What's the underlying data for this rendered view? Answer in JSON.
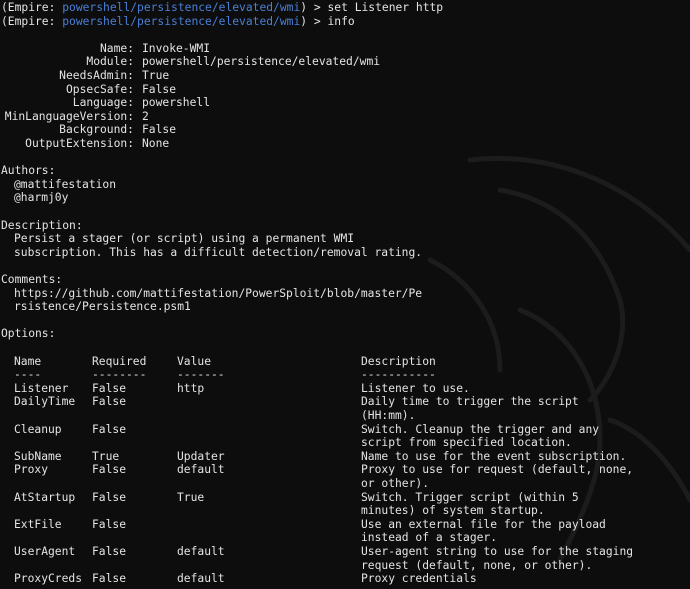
{
  "prompt": {
    "prefix": "(Empire: ",
    "path": "powershell/persistence/elevated/wmi",
    "suffix": ") > "
  },
  "commands": [
    "set Listener http",
    "info"
  ],
  "module_info": [
    {
      "key": "Name",
      "value": "Invoke-WMI"
    },
    {
      "key": "Module",
      "value": "powershell/persistence/elevated/wmi"
    },
    {
      "key": "NeedsAdmin",
      "value": "True"
    },
    {
      "key": "OpsecSafe",
      "value": "False"
    },
    {
      "key": "Language",
      "value": "powershell"
    },
    {
      "key": "MinLanguageVersion",
      "value": "2"
    },
    {
      "key": "Background",
      "value": "False"
    },
    {
      "key": "OutputExtension",
      "value": "None"
    }
  ],
  "authors": {
    "heading": "Authors:",
    "names": [
      "@mattifestation",
      "@harmj0y"
    ]
  },
  "description": {
    "heading": "Description:",
    "lines": [
      "Persist a stager (or script) using a permanent WMI",
      "subscription. This has a difficult detection/removal rating."
    ]
  },
  "comments": {
    "heading": "Comments:",
    "lines": [
      "https://github.com/mattifestation/PowerSploit/blob/master/Pe",
      "rsistence/Persistence.psm1"
    ]
  },
  "options": {
    "heading": "Options:",
    "headers": [
      "Name",
      "Required",
      "Value",
      "Description"
    ],
    "underlines": [
      "----",
      "--------",
      "-------",
      "-----------"
    ],
    "rows": [
      {
        "name": "Listener",
        "required": "False",
        "value": "http",
        "desc": [
          "Listener to use."
        ]
      },
      {
        "name": "DailyTime",
        "required": "False",
        "value": "",
        "desc": [
          "Daily time to trigger the script",
          "(HH:mm)."
        ]
      },
      {
        "name": "Cleanup",
        "required": "False",
        "value": "",
        "desc": [
          "Switch. Cleanup the trigger and any",
          "script from specified location."
        ]
      },
      {
        "name": "SubName",
        "required": "True",
        "value": "Updater",
        "desc": [
          "Name to use for the event subscription."
        ]
      },
      {
        "name": "Proxy",
        "required": "False",
        "value": "default",
        "desc": [
          "Proxy to use for request (default, none,",
          "or other)."
        ]
      },
      {
        "name": "AtStartup",
        "required": "False",
        "value": "True",
        "desc": [
          "Switch. Trigger script (within 5",
          "minutes) of system startup."
        ]
      },
      {
        "name": "ExtFile",
        "required": "False",
        "value": "",
        "desc": [
          "Use an external file for the payload",
          "instead of a stager."
        ]
      },
      {
        "name": "UserAgent",
        "required": "False",
        "value": "default",
        "desc": [
          "User-agent string to use for the staging",
          "request (default, none, or other)."
        ]
      },
      {
        "name": "ProxyCreds",
        "required": "False",
        "value": "default",
        "desc": [
          "Proxy credentials"
        ]
      }
    ]
  },
  "colors": {
    "background": "#0d0d0d",
    "text": "#e4e4e4",
    "path": "#4a7fd6"
  },
  "icons": {
    "background": "kali-dragon-logo"
  }
}
